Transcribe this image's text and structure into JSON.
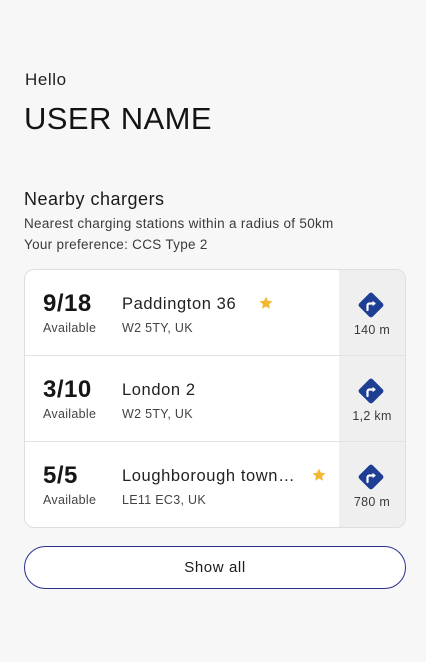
{
  "header": {
    "greeting": "Hello",
    "user_name": "USER NAME"
  },
  "nearby": {
    "title": "Nearby chargers",
    "subtitle": "Nearest charging stations within a radius of 50km",
    "preference": "Your preference: CCS Type 2"
  },
  "chargers": [
    {
      "count": "9/18",
      "status": "Available",
      "name": "Paddington 36",
      "address": "W2 5TY, UK",
      "favorite": true,
      "distance": "140 m"
    },
    {
      "count": "3/10",
      "status": "Available",
      "name": "London 2",
      "address": "W2 5TY, UK",
      "favorite": false,
      "distance": "1,2 km"
    },
    {
      "count": "5/5",
      "status": "Available",
      "name": "Loughborough towncentre",
      "address": "LE11 EC3, UK",
      "favorite": true,
      "distance": "780 m"
    }
  ],
  "actions": {
    "show_all": "Show all"
  },
  "icons": {
    "route": "directions-icon",
    "favorite": "star-icon"
  },
  "colors": {
    "accent": "#2a2f8c",
    "star": "#f5b731",
    "route_icon": "#1d3e92",
    "background": "#f7f7f8"
  }
}
